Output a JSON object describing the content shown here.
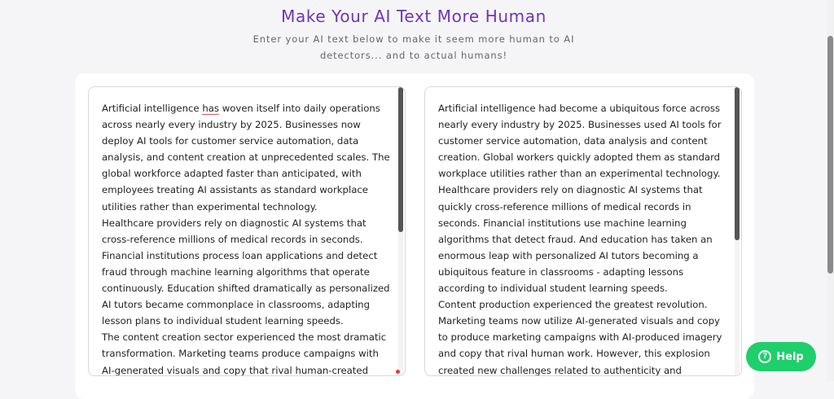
{
  "header": {
    "title": "Make Your AI Text More Human",
    "subtitle": "Enter your AI text below to make it seem more human to AI detectors... and to actual humans!"
  },
  "input_panel": {
    "text_before_flag": "Artificial intelligence ",
    "flagged_word": "has",
    "text_after_flag": " woven itself into daily operations across nearly every industry by 2025. Businesses now deploy AI tools for customer service automation, data analysis, and content creation at unprecedented scales. The global workforce adapted faster than anticipated, with employees treating AI assistants as standard workplace utilities rather than experimental technology.",
    "paragraph_2": "Healthcare providers rely on diagnostic AI systems that cross-reference millions of medical records in seconds. Financial institutions process loan applications and detect fraud through machine learning algorithms that operate continuously. Education shifted dramatically as personalized AI tutors became commonplace in classrooms, adapting lesson plans to individual student learning speeds.",
    "paragraph_3": "The content creation sector experienced the most dramatic transformation. Marketing teams produce campaigns with AI-generated visuals and copy that rival human-created work."
  },
  "output_panel": {
    "paragraph_1": "Artificial intelligence had become a ubiquitous force across nearly every industry by 2025. Businesses used AI tools for customer service automation, data analysis and content creation. Global workers quickly adopted them as standard workplace utilities rather than an experimental technology. Healthcare providers rely on diagnostic AI systems that quickly cross-reference millions of medical records in seconds. Financial institutions use machine learning algorithms that detect fraud. And education has taken an enormous leap with personalized AI tutors becoming a ubiquitous feature in classrooms - adapting lessons according to individual student learning speeds.",
    "paragraph_2": "Content production experienced the greatest revolution. Marketing teams now utilize AI-generated visuals and copy to produce marketing campaigns with AI-produced imagery and copy that rival human work. However, this explosion created new challenges related to authenticity and"
  },
  "help_button": {
    "label": "Help",
    "icon_glyph": "?"
  }
}
